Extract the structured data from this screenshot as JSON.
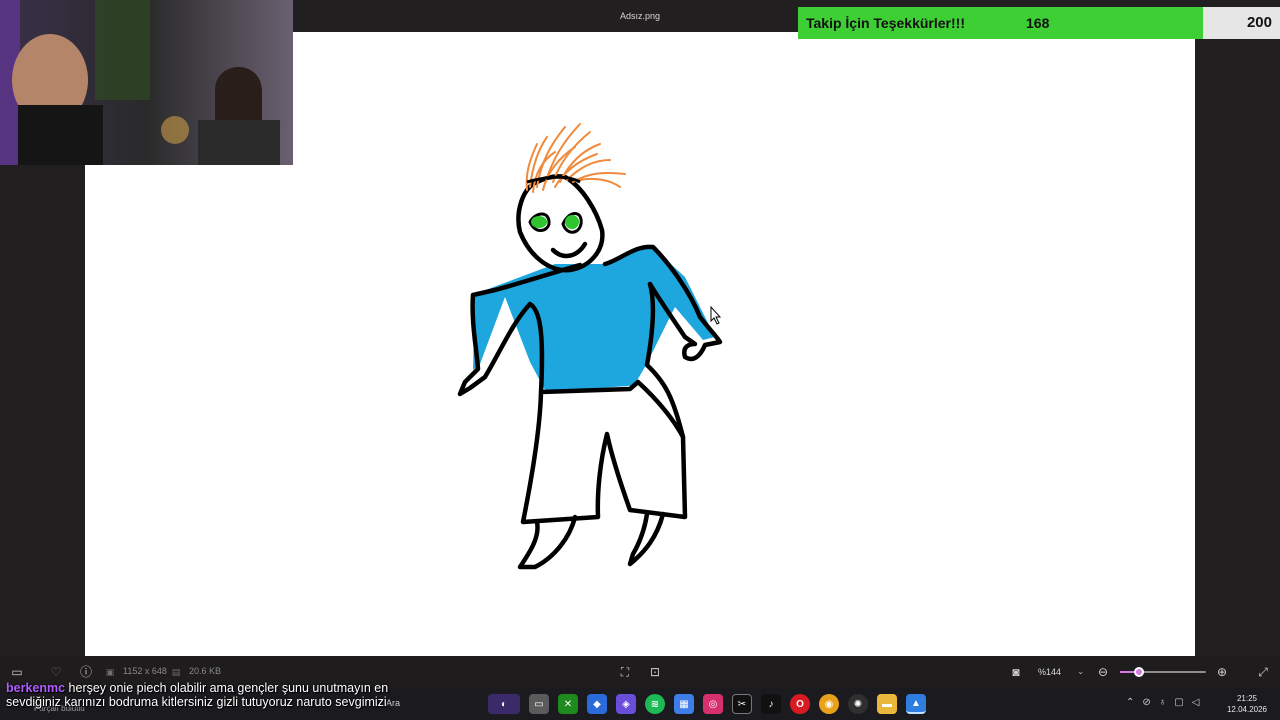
{
  "window": {
    "title": "Adsız.png"
  },
  "goal": {
    "title": "Takip İçin Teşekkürler!!!",
    "current": "168",
    "target": "200",
    "progress": 0.84,
    "fill_color": "#3ecf34"
  },
  "toolbar": {
    "dimensions": "1152 x 648",
    "file_size": "20.6 KB",
    "zoom": "%144",
    "zoom_level": 0.22,
    "accent": "#d77be0"
  },
  "taskbar": {
    "status_text": "Parçalı bulutlu",
    "search_label": "Ara",
    "time": "21:25",
    "date": "12.04.2026",
    "apps": [
      "game-bar",
      "file-explorer-window",
      "xbox",
      "m365",
      "copilot",
      "spotify",
      "store",
      "instagram",
      "capcut",
      "tiktok",
      "opera",
      "chrome",
      "chatgpt",
      "file-explorer",
      "photos"
    ]
  },
  "chat": {
    "username": "berkenmc",
    "message": " herşey onie piech olabilir ama gençler şunu unutmayın en sevdiğiniz karınızı bodruma kitlersiniz gizli tutuyoruz naruto sevgimizi"
  },
  "drawing": {
    "description_colors": {
      "hair": "#f08a3c",
      "eyes": "#2fc52f",
      "shirt": "#1ea7df",
      "outline": "#000000"
    }
  }
}
